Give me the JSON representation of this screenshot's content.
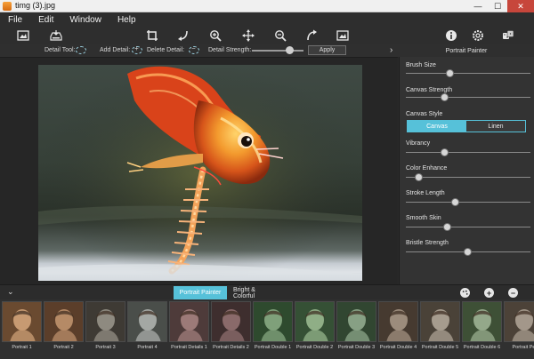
{
  "window": {
    "title": "timg (3).jpg",
    "min_glyph": "—",
    "max_glyph": "☐",
    "close_glyph": "✕"
  },
  "menu": [
    "File",
    "Edit",
    "Window",
    "Help"
  ],
  "detail_bar": {
    "detail_tool_label": "Detail Tool:",
    "add_detail_label": "Add Detail:",
    "delete_detail_label": "Delete Detail:",
    "detail_strength_label": "Detail Strength:",
    "detail_strength_value": 0.72,
    "apply_label": "Apply",
    "next_glyph": "›"
  },
  "panel": {
    "title": "Portrait Painter",
    "sliders": [
      {
        "label": "Brush Size",
        "value": 0.35
      },
      {
        "label": "Canvas Strength",
        "value": 0.31
      }
    ],
    "canvas_style": {
      "label": "Canvas Style",
      "options": [
        "Canvas",
        "Linen"
      ],
      "selected": "Canvas"
    },
    "sliders2": [
      {
        "label": "Vibrancy",
        "value": 0.31
      },
      {
        "label": "Color Enhance",
        "value": 0.1
      },
      {
        "label": "Stroke Length",
        "value": 0.39
      },
      {
        "label": "Smooth Skin",
        "value": 0.33
      },
      {
        "label": "Bristle Strength",
        "value": 0.49
      }
    ]
  },
  "bottom": {
    "collapse_glyph": "⌄",
    "tabs": [
      "Portrait Painter",
      "Bright & Colorful"
    ],
    "active_tab": "Portrait Painter",
    "add_glyph": "+",
    "remove_glyph": "−"
  },
  "thumbnails": [
    "Portrait 1",
    "Portrait 2",
    "Portrait 3",
    "Portrait 4",
    "Portrait Details 1",
    "Portrait Details 2",
    "Portrait Double 1",
    "Portrait Double 2",
    "Portrait Double 3",
    "Portrait Double 4",
    "Portrait Double 5",
    "Portrait Double 6",
    "Portrait Pe"
  ],
  "colors": {
    "accent": "#56c1d9",
    "panel": "#333333",
    "toolbar": "#2e2e2e"
  }
}
